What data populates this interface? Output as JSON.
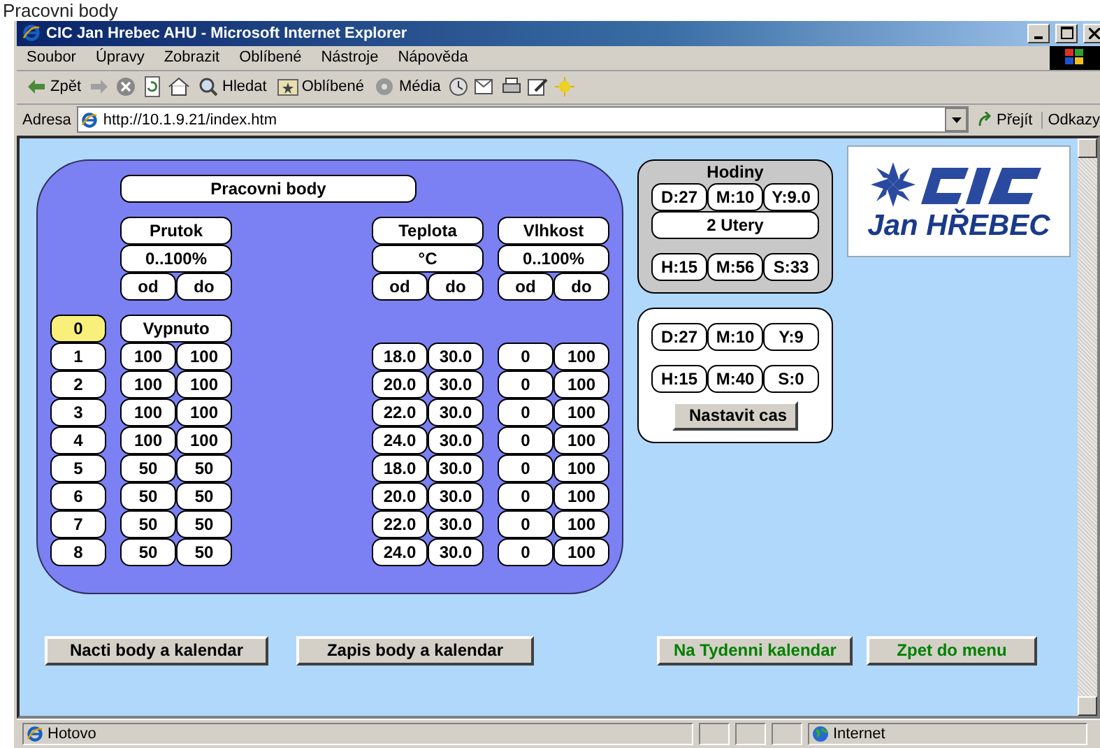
{
  "page_caption": "Pracovni body",
  "window": {
    "title": "CIC Jan Hrebec AHU - Microsoft Internet Explorer"
  },
  "menu": [
    "Soubor",
    "Úpravy",
    "Zobrazit",
    "Oblíbené",
    "Nástroje",
    "Nápověda"
  ],
  "toolbar": [
    {
      "kind": "back",
      "label": "Zpět"
    },
    {
      "kind": "forward"
    },
    {
      "kind": "stop"
    },
    {
      "kind": "refresh"
    },
    {
      "kind": "home"
    },
    {
      "kind": "search",
      "label": "Hledat"
    },
    {
      "kind": "favorites",
      "label": "Oblíbené"
    },
    {
      "kind": "media",
      "label": "Média"
    },
    {
      "kind": "history"
    },
    {
      "kind": "mail"
    },
    {
      "kind": "print"
    },
    {
      "kind": "edit"
    },
    {
      "kind": "messenger"
    }
  ],
  "address": {
    "label": "Adresa",
    "value": "http://10.1.9.21/index.htm",
    "go": "Přejít",
    "links": "Odkazy"
  },
  "points": {
    "title": "Pracovni body",
    "groups": [
      {
        "name": "Prutok",
        "unit": "0..100%",
        "from": "od",
        "to": "do"
      },
      {
        "name": "Teplota",
        "unit": "°C",
        "from": "od",
        "to": "do"
      },
      {
        "name": "Vlhkost",
        "unit": "0..100%",
        "from": "od",
        "to": "do"
      }
    ],
    "off_label": "Vypnuto",
    "rows": [
      {
        "index": "0",
        "selected": true,
        "values": []
      },
      {
        "index": "1",
        "selected": false,
        "values": [
          [
            "100",
            "100"
          ],
          [
            "18.0",
            "30.0"
          ],
          [
            "0",
            "100"
          ]
        ]
      },
      {
        "index": "2",
        "selected": false,
        "values": [
          [
            "100",
            "100"
          ],
          [
            "20.0",
            "30.0"
          ],
          [
            "0",
            "100"
          ]
        ]
      },
      {
        "index": "3",
        "selected": false,
        "values": [
          [
            "100",
            "100"
          ],
          [
            "22.0",
            "30.0"
          ],
          [
            "0",
            "100"
          ]
        ]
      },
      {
        "index": "4",
        "selected": false,
        "values": [
          [
            "100",
            "100"
          ],
          [
            "24.0",
            "30.0"
          ],
          [
            "0",
            "100"
          ]
        ]
      },
      {
        "index": "5",
        "selected": false,
        "values": [
          [
            "50",
            "50"
          ],
          [
            "18.0",
            "30.0"
          ],
          [
            "0",
            "100"
          ]
        ]
      },
      {
        "index": "6",
        "selected": false,
        "values": [
          [
            "50",
            "50"
          ],
          [
            "20.0",
            "30.0"
          ],
          [
            "0",
            "100"
          ]
        ]
      },
      {
        "index": "7",
        "selected": false,
        "values": [
          [
            "50",
            "50"
          ],
          [
            "22.0",
            "30.0"
          ],
          [
            "0",
            "100"
          ]
        ]
      },
      {
        "index": "8",
        "selected": false,
        "values": [
          [
            "50",
            "50"
          ],
          [
            "24.0",
            "30.0"
          ],
          [
            "0",
            "100"
          ]
        ]
      }
    ]
  },
  "clock": {
    "title": "Hodiny",
    "date": [
      "D:27",
      "M:10",
      "Y:9.0"
    ],
    "day": "2 Utery",
    "time": [
      "H:15",
      "M:56",
      "S:33"
    ]
  },
  "set_clock": {
    "date": [
      "D:27",
      "M:10",
      "Y:9"
    ],
    "time": [
      "H:15",
      "M:40",
      "S:0"
    ],
    "button": "Nastavit cas"
  },
  "logo": {
    "text": "Jan HŘEBEC"
  },
  "buttons": [
    {
      "label": "Nacti body a kalendar",
      "kind": "data"
    },
    {
      "label": "Zapis body a kalendar",
      "kind": "data"
    },
    {
      "label": "Na Tydenni kalendar",
      "kind": "nav"
    },
    {
      "label": "Zpet do menu",
      "kind": "nav"
    }
  ],
  "status_bar": {
    "text": "Hotovo",
    "zone": "Internet"
  }
}
